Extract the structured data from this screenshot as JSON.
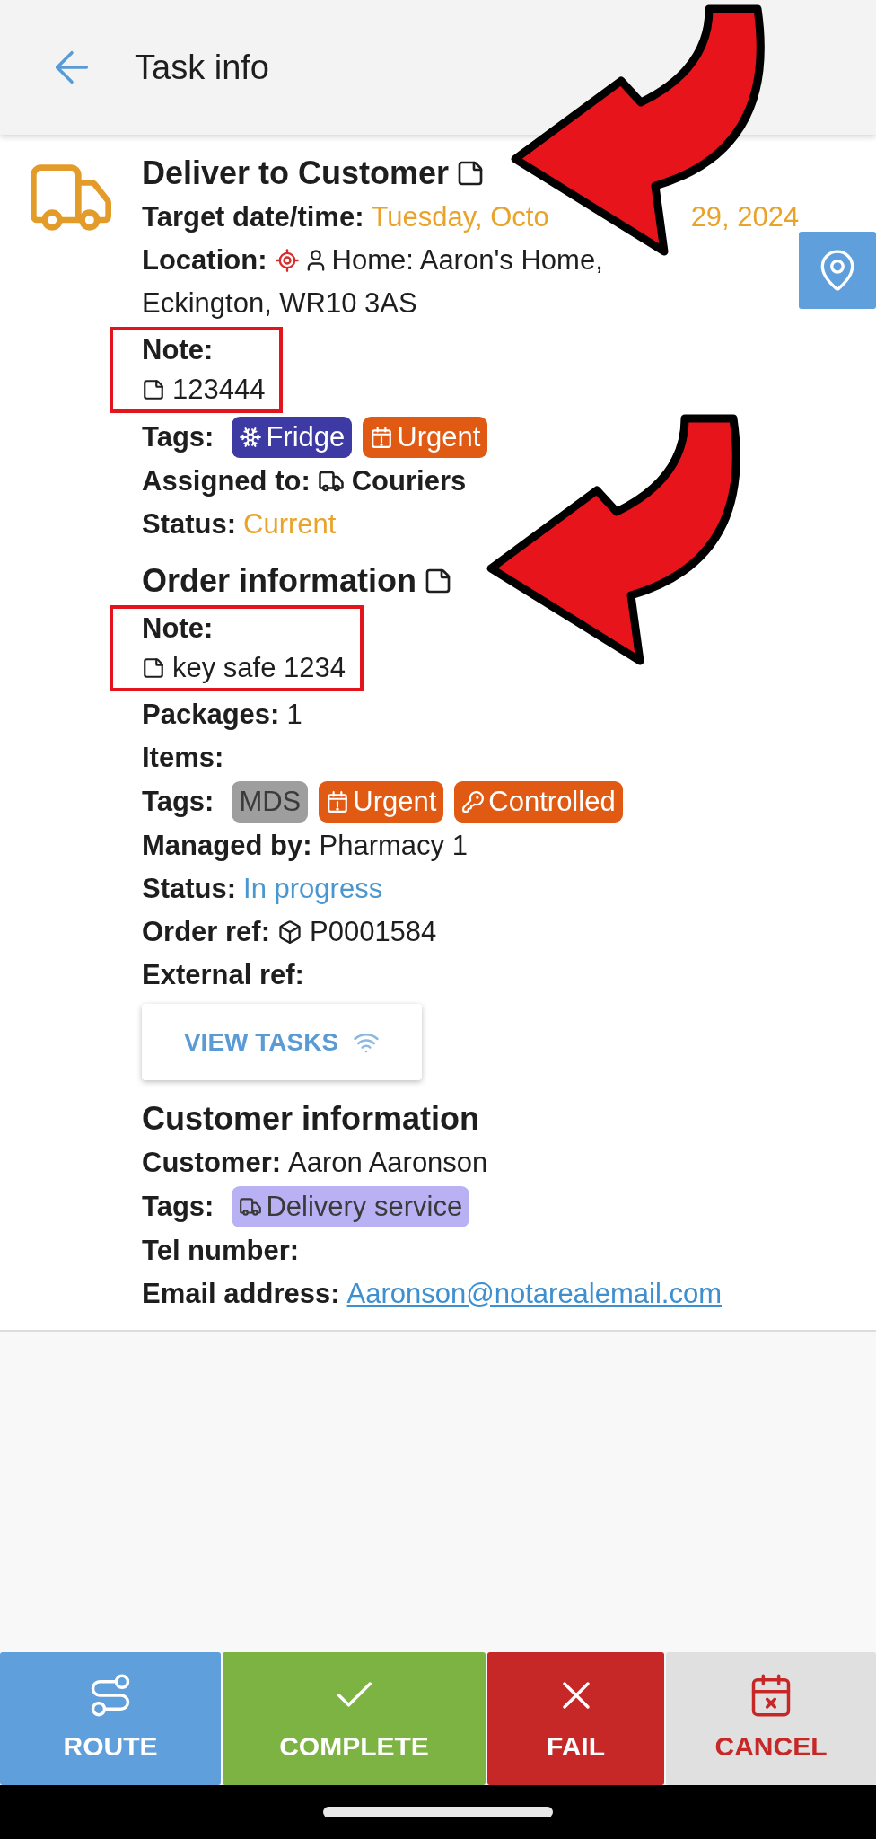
{
  "header": {
    "title": "Task info"
  },
  "sections": [
    {
      "title": "Deliver to Customer",
      "has_note": true,
      "has_map_button": true,
      "has_truck": true,
      "fields": [
        {
          "kind": "date",
          "label": "Target date/time:",
          "value_parts": [
            "Tuesday, Octo",
            "29, 2024"
          ],
          "color": "#eaa32a"
        },
        {
          "kind": "location",
          "label": "Location:",
          "lines": [
            "Home: Aaron's Home,",
            "Eckington, WR10 3AS"
          ]
        },
        {
          "kind": "note",
          "label": "Note:",
          "value": "123444",
          "highlighted": true
        },
        {
          "kind": "tags",
          "label": "Tags:",
          "tags": [
            {
              "label": "Fridge",
              "color": "#3d3aa3",
              "kind": "snowflake"
            },
            {
              "label": "Urgent",
              "color": "#e05a14",
              "kind": "alert"
            }
          ]
        },
        {
          "kind": "assigned",
          "label": "Assigned to:",
          "value": "Couriers"
        },
        {
          "kind": "status",
          "label": "Status:",
          "value": "Current",
          "color": "#eaa32a"
        }
      ]
    },
    {
      "title": "Order information",
      "has_note": true,
      "has_map_button": false,
      "has_truck": false,
      "fields": [
        {
          "kind": "note",
          "label": "Note:",
          "value": "key safe 1234",
          "highlighted": true
        },
        {
          "kind": "text",
          "label": "Packages:",
          "value": "1"
        },
        {
          "kind": "text",
          "label": "Items:"
        },
        {
          "kind": "tags",
          "label": "Tags:",
          "tags": [
            {
              "label": "MDS",
              "color": "#9e9e9e",
              "kind": "plain"
            },
            {
              "label": "Urgent",
              "color": "#e05a14",
              "kind": "alert"
            },
            {
              "label": "Controlled",
              "color": "#e05a14",
              "kind": "key"
            }
          ]
        },
        {
          "kind": "text",
          "label": "Managed by:",
          "value": "Pharmacy 1"
        },
        {
          "kind": "status",
          "label": "Status:",
          "value": "In progress",
          "color": "#4a97cf"
        },
        {
          "kind": "ref",
          "label": "Order ref:",
          "value": "P0001584"
        },
        {
          "kind": "text",
          "label": "External ref:"
        },
        {
          "kind": "button",
          "label": "VIEW TASKS"
        }
      ]
    },
    {
      "title": "Customer information",
      "has_note": false,
      "has_map_button": false,
      "has_truck": false,
      "fields": [
        {
          "kind": "text",
          "label": "Customer:",
          "value": "Aaron Aaronson"
        },
        {
          "kind": "tags",
          "label": "Tags:",
          "tags": [
            {
              "label": "Delivery service",
              "color": "#b8b2f4",
              "kind": "truck"
            }
          ]
        },
        {
          "kind": "text",
          "label": "Tel number:"
        },
        {
          "kind": "link",
          "label": "Email address:",
          "value": "Aaronson@notarealemail.com"
        }
      ]
    }
  ],
  "actions": [
    {
      "label": "ROUTE",
      "kind": "route"
    },
    {
      "label": "COMPLETE",
      "kind": "complete"
    },
    {
      "label": "FAIL",
      "kind": "fail"
    },
    {
      "label": "CANCEL",
      "kind": "cancel"
    }
  ]
}
